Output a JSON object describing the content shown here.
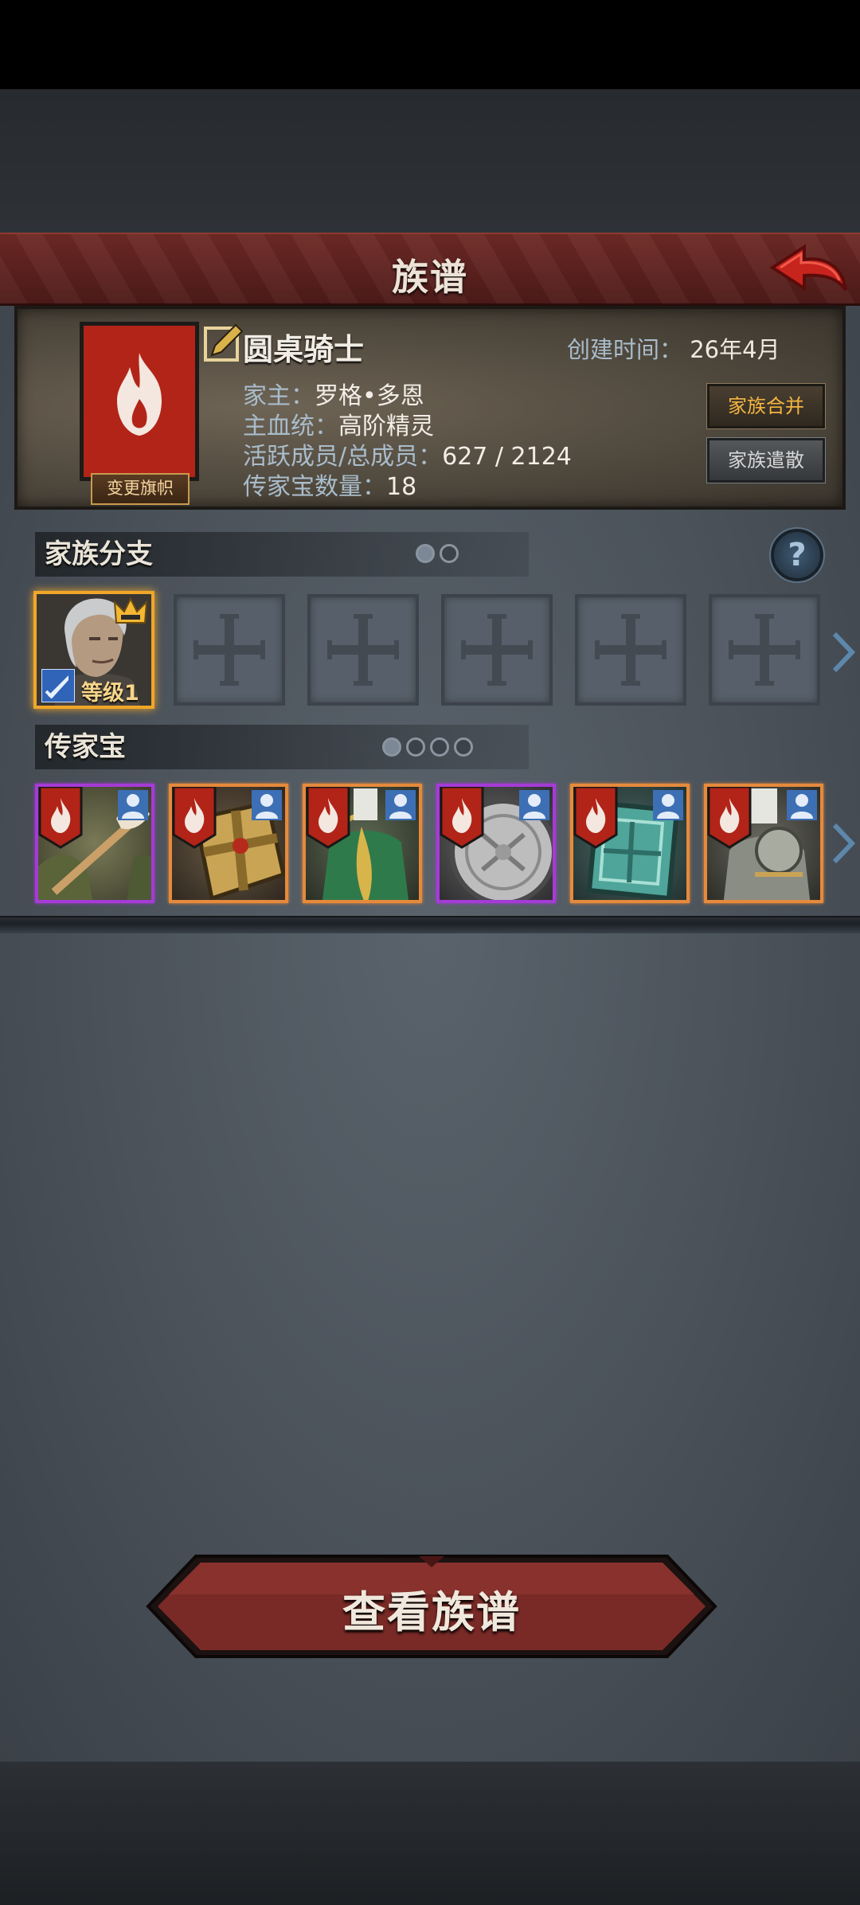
{
  "header": {
    "title": "族谱",
    "back_icon": "back-arrow-icon"
  },
  "family": {
    "name": "圆桌骑士",
    "created_label": "创建时间：",
    "created_value": "26年4月",
    "head_label": "家主：",
    "head_value": "罗格•多恩",
    "bloodline_label": "主血统：",
    "bloodline_value": "高阶精灵",
    "members_label": "活跃成员/总成员：",
    "members_value": "627 / 2124",
    "heirloom_count_label": "传家宝数量：",
    "heirloom_count_value": "18",
    "change_banner_label": "变更旗帜",
    "merge_button": "家族合并",
    "disband_button": "家族遣散"
  },
  "branches": {
    "title": "家族分支",
    "leader_level": "等级1",
    "empty_slots": 5,
    "help_label": "?"
  },
  "heirlooms": {
    "title": "传家宝",
    "items": [
      {
        "rarity": "purple",
        "icon": "fur-staff-icon"
      },
      {
        "rarity": "orange",
        "icon": "golden-cross-shield-icon"
      },
      {
        "rarity": "orange",
        "icon": "green-armor-icon"
      },
      {
        "rarity": "purple",
        "icon": "silver-round-shield-icon"
      },
      {
        "rarity": "orange",
        "icon": "jade-shield-icon"
      },
      {
        "rarity": "orange",
        "icon": "silver-armor-icon"
      }
    ]
  },
  "footer": {
    "view_button": "查看族谱"
  },
  "colors": {
    "banner_red": "#b22418",
    "accent_gold": "#f3b541",
    "rarity_purple": "#a53bd6",
    "rarity_orange": "#e58a3c"
  }
}
